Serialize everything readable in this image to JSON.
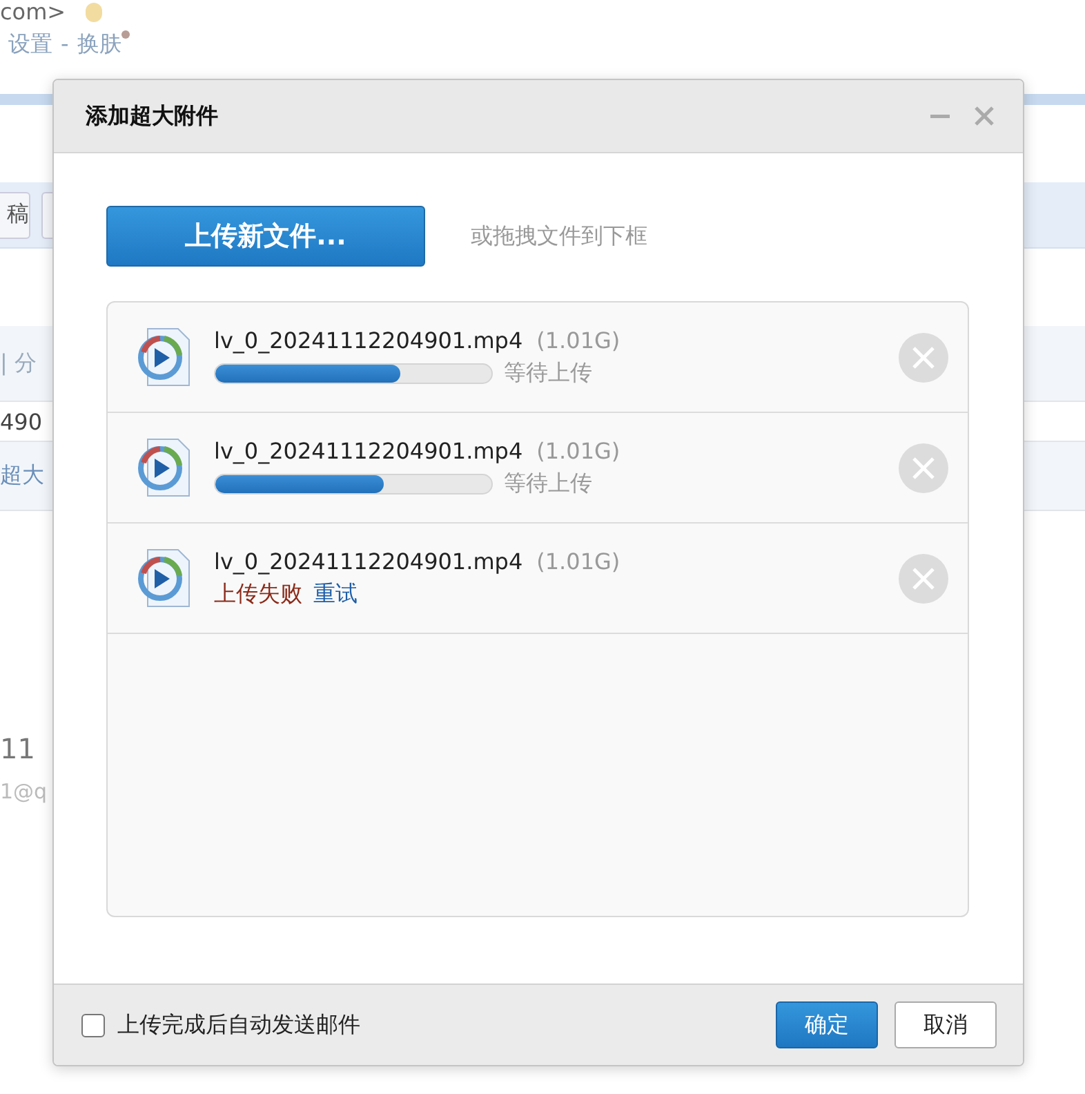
{
  "background": {
    "address": "com>",
    "links": [
      "设置",
      "-",
      "换肤"
    ],
    "toolbar_button": "稿",
    "row_1": "| 分",
    "row_2": "490",
    "row_3": "超大",
    "name": "11",
    "email": "1@q"
  },
  "dialog": {
    "title": "添加超大附件",
    "upload_button": "上传新文件...",
    "drop_hint": "或拖拽文件到下框",
    "files": [
      {
        "name": "lv_0_20241112204901.mp4",
        "size": "(1.01G)",
        "kind": "progress",
        "level": 0.67,
        "status": "等待上传"
      },
      {
        "name": "lv_0_20241112204901.mp4",
        "size": "(1.01G)",
        "kind": "progress",
        "level": 0.61,
        "status": "等待上传"
      },
      {
        "name": "lv_0_20241112204901.mp4",
        "size": "(1.01G)",
        "kind": "failed",
        "status": "上传失败",
        "retry": "重试"
      }
    ],
    "auto_send": {
      "label": "上传完成后自动发送邮件",
      "checked": false
    },
    "buttons": [
      {
        "label": "确定",
        "kind": "primary"
      },
      {
        "label": "取消",
        "kind": "secondary"
      }
    ]
  }
}
